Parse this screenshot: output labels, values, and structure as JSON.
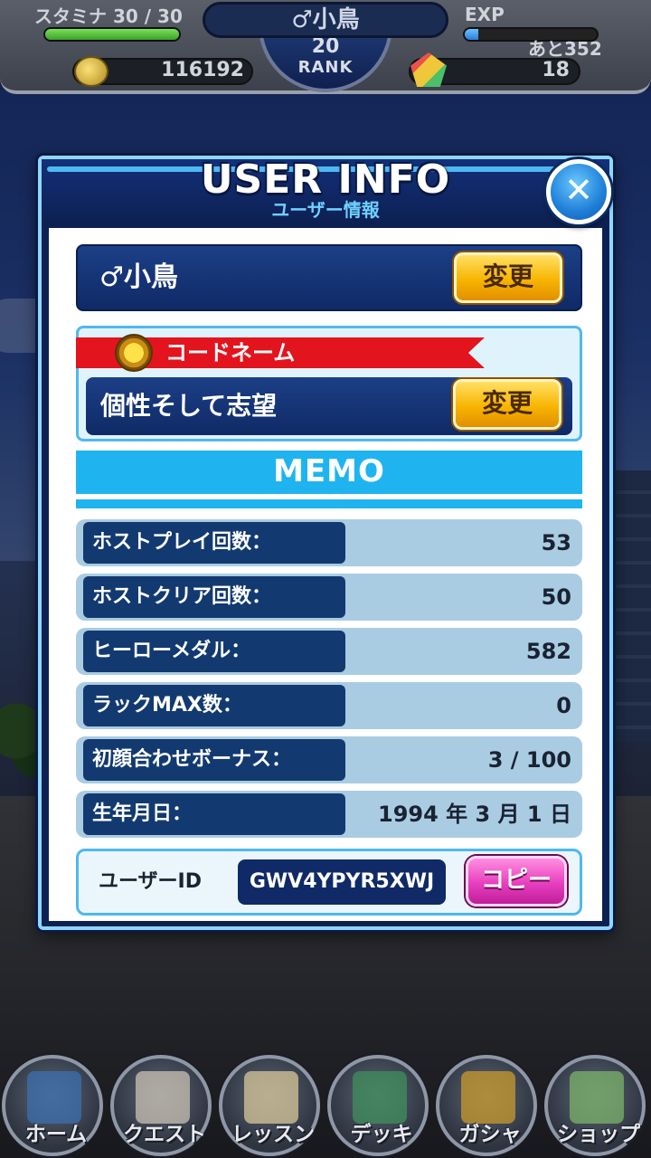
{
  "hud": {
    "stamina_label": "スタミナ 30 / 30",
    "stamina_fraction": 1.0,
    "player_name": "♂小鳥",
    "rank_value": "20",
    "rank_label": "RANK",
    "exp_label": "EXP",
    "exp_fraction": 0.1,
    "exp_remaining": "あと352",
    "coins": "116192",
    "gems": "18"
  },
  "modal": {
    "title": "USER INFO",
    "subtitle": "ユーザー情報",
    "close_label": "✕",
    "player_name": "♂小鳥",
    "change_button": "変更",
    "codename_label": "コードネーム",
    "codename_value": "個性そして志望",
    "memo_title": "MEMO",
    "stats": [
      {
        "label": "ホストプレイ回数：",
        "value": "53"
      },
      {
        "label": "ホストクリア回数：",
        "value": "50"
      },
      {
        "label": "ヒーローメダル：",
        "value": "582"
      },
      {
        "label": "ラックMAX数：",
        "value": "0"
      },
      {
        "label": "初顔合わせボーナス：",
        "value": "3 / 100"
      },
      {
        "label": "生年月日：",
        "value": "1994 年 3 月 1 日"
      }
    ],
    "user_id_label": "ユーザーID",
    "user_id_value": "GWV4YPYR5XWJ",
    "copy_button": "コピー"
  },
  "bottom_nav": {
    "items": [
      {
        "label": "ホーム",
        "icon": "home-building-icon",
        "color": "#3e6fae"
      },
      {
        "label": "クエスト",
        "icon": "fist-icon",
        "color": "#c9c2b4"
      },
      {
        "label": "レッスン",
        "icon": "clipboard-icon",
        "color": "#d8c79a"
      },
      {
        "label": "デッキ",
        "icon": "cards-icon",
        "color": "#3f8f5c"
      },
      {
        "label": "ガシャ",
        "icon": "gacha-case-icon",
        "color": "#c99a2e"
      },
      {
        "label": "ショップ",
        "icon": "gem-icon",
        "color": "#7ab36a"
      }
    ]
  },
  "colors": {
    "modal_border": "#8fd6ff",
    "memo_bar": "#1fb4ef",
    "change_button": "#f7b500",
    "copy_button": "#e83fc0",
    "codename_ribbon": "#e3141d"
  }
}
